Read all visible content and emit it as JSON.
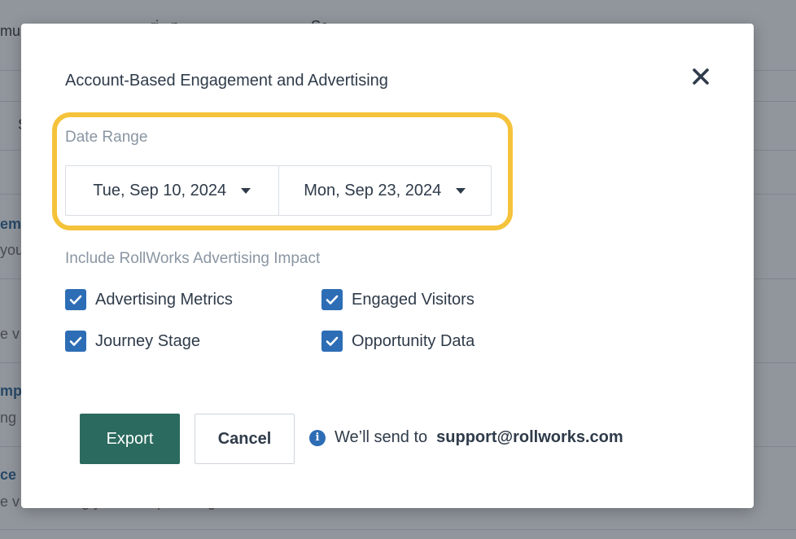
{
  "background": {
    "fragments": [
      "mu",
      "ri",
      "p",
      "Sc",
      "S",
      "em",
      "you",
      "e v",
      "mp",
      "ng",
      "ce",
      "e v",
      "g y",
      "mp",
      "g"
    ]
  },
  "modal": {
    "title": "Account-Based Engagement and Advertising",
    "close_icon": "close-x-icon",
    "date_range": {
      "label": "Date Range",
      "start": "Tue, Sep 10, 2024",
      "end": "Mon, Sep 23, 2024"
    },
    "impact": {
      "label": "Include RollWorks Advertising Impact",
      "options": [
        {
          "label": "Advertising Metrics",
          "checked": true
        },
        {
          "label": "Engaged Visitors",
          "checked": true
        },
        {
          "label": "Journey Stage",
          "checked": true
        },
        {
          "label": "Opportunity Data",
          "checked": true
        }
      ]
    },
    "actions": {
      "export_label": "Export",
      "cancel_label": "Cancel",
      "note_prefix": "We’ll send to",
      "email": "support@rollworks.com"
    }
  },
  "colors": {
    "primary": "#2b6a5e",
    "checkbox": "#2d6db5",
    "highlight": "#f5c33b"
  }
}
